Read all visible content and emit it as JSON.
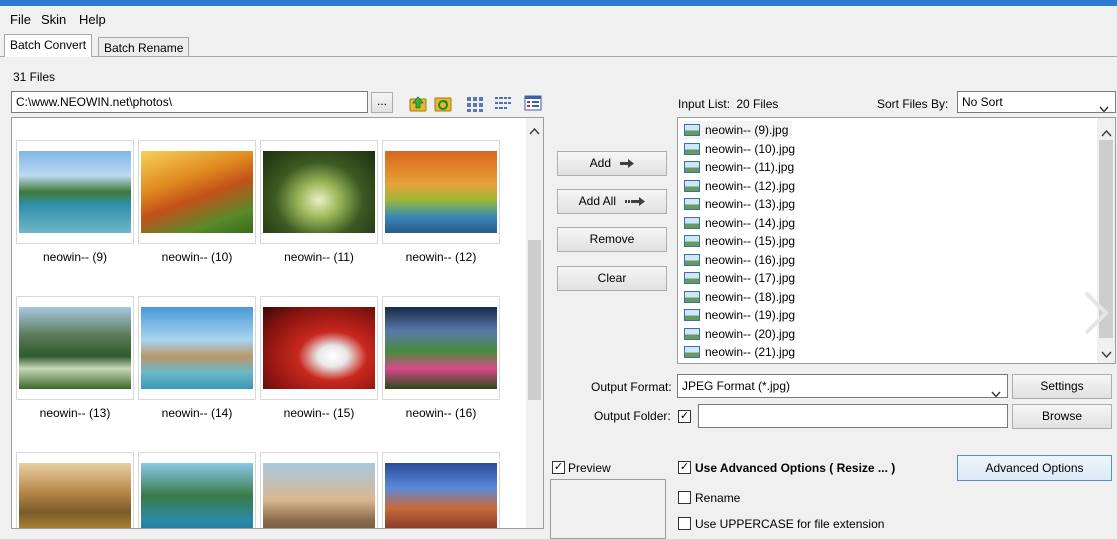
{
  "menu": {
    "file": "File",
    "skin": "Skin",
    "help": "Help"
  },
  "tabs": {
    "batch_convert": "Batch Convert",
    "batch_rename": "Batch Rename"
  },
  "file_count": "31 Files",
  "path": {
    "value": "C:\\www.NEOWIN.net\\photos\\",
    "browse_label": "..."
  },
  "thumbnails": [
    {
      "label": "neowin-- (9)"
    },
    {
      "label": "neowin-- (10)"
    },
    {
      "label": "neowin-- (11)"
    },
    {
      "label": "neowin-- (12)"
    },
    {
      "label": "neowin-- (13)"
    },
    {
      "label": "neowin-- (14)"
    },
    {
      "label": "neowin-- (15)"
    },
    {
      "label": "neowin-- (16)"
    },
    {
      "label": ""
    },
    {
      "label": ""
    },
    {
      "label": ""
    },
    {
      "label": ""
    }
  ],
  "actions": {
    "add": "Add",
    "add_all": "Add All",
    "remove": "Remove",
    "clear": "Clear"
  },
  "input_list": {
    "label": "Input List:",
    "count": "20 Files",
    "sort_label": "Sort Files By:",
    "sort_value": "No Sort",
    "files": [
      "neowin-- (9).jpg",
      "neowin-- (10).jpg",
      "neowin-- (11).jpg",
      "neowin-- (12).jpg",
      "neowin-- (13).jpg",
      "neowin-- (14).jpg",
      "neowin-- (15).jpg",
      "neowin-- (16).jpg",
      "neowin-- (17).jpg",
      "neowin-- (18).jpg",
      "neowin-- (19).jpg",
      "neowin-- (20).jpg",
      "neowin-- (21).jpg"
    ]
  },
  "output": {
    "format_label": "Output Format:",
    "format_value": "JPEG Format (*.jpg)",
    "settings": "Settings",
    "folder_label": "Output Folder:",
    "folder_value": "",
    "browse": "Browse"
  },
  "preview": {
    "label": "Preview",
    "checked": true
  },
  "advanced": {
    "use_label": "Use Advanced Options ( Resize ... )",
    "button": "Advanced Options",
    "rename": "Rename",
    "uppercase": "Use UPPERCASE for file extension"
  },
  "icons": [
    "folder-up-icon",
    "refresh-folder-icon",
    "thumbnail-view-icon",
    "list-view-icon",
    "detail-view-icon",
    "scroll-up-icon",
    "scroll-down-icon",
    "dropdown-arrow-icon",
    "arrow-right-icon",
    "next-arrow-icon"
  ]
}
